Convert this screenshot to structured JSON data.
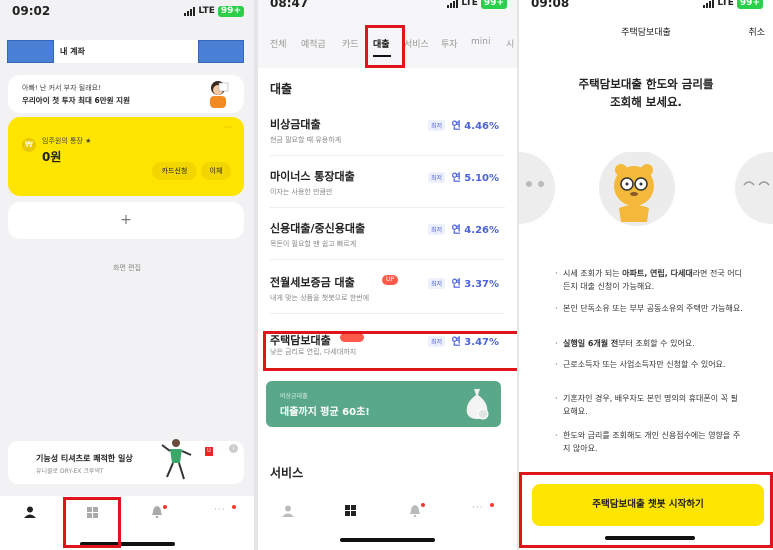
{
  "screen1": {
    "time": "09:02",
    "network": "LTE",
    "battery": "99+",
    "account_label": "내 계좌",
    "promo_line1": "아빠! 난 커서 부자 될래요!",
    "promo_line2": "우리아이 첫 투자 최대 6만원 지원",
    "account_name": "임주원의 통장 ★",
    "balance": "0원",
    "btn_card": "카드신청",
    "btn_transfer": "이체",
    "add_symbol": "+",
    "edit_screen": "화면 편집",
    "ad_title": "기능성 티셔츠로 쾌적한 일상",
    "ad_sub": "유니클로 DRY-EX 크루넥T",
    "ad_info": "i",
    "nav_more": "···"
  },
  "screen2": {
    "time": "08:47",
    "network": "LTE",
    "battery": "99+",
    "tabs": [
      "전체",
      "예적금",
      "카드",
      "대출",
      "서비스",
      "투자",
      "mini",
      "시"
    ],
    "section_title": "대출",
    "loans": [
      {
        "title": "비상금대출",
        "sub": "현금 필요할 때 유용하게",
        "badge": "최저",
        "rate": "연 4.46%"
      },
      {
        "title": "마이너스 통장대출",
        "sub": "이자는 사용한 만큼만",
        "badge": "최저",
        "rate": "연 5.10%"
      },
      {
        "title": "신용대출/중신용대출",
        "sub": "목돈이 필요할 땐 쉽고 빠르게",
        "badge": "최저",
        "rate": "연 4.26%"
      },
      {
        "title": "전월세보증금 대출",
        "sub": "내게 맞는 상품을 챗봇으로 한번에",
        "badge": "최저",
        "rate": "연 3.37%",
        "tag": "UP"
      },
      {
        "title": "주택담보대출",
        "sub": "낮은 금리로 연립, 다세대까지",
        "badge": "최저",
        "rate": "연 3.47%"
      }
    ],
    "banner_small": "비상금대출",
    "banner_big": "대출까지 평균 60초!",
    "services_title": "서비스",
    "nav_more": "···"
  },
  "screen3": {
    "time": "09:08",
    "network": "LTE",
    "battery": "99+",
    "header_title": "주택담보대출",
    "cancel": "취소",
    "headline1": "주택담보대출 한도와 금리를",
    "headline2": "조회해 보세요.",
    "bullets": [
      [
        "시세 조회가 되는 ",
        "아파트, 연립, 다세대",
        "라면 전국 어디든지 대출 신청이 가능해요."
      ],
      [
        "본인 단독소유 또는 부부 공동소유의 주택만 가능해요.",
        "",
        ""
      ],
      [
        "",
        "실행일 6개월 전",
        "부터 조회할 수 있어요."
      ],
      [
        "근로소득자 또는 사업소득자만 신청할 수 있어요.",
        "",
        ""
      ],
      [
        "기혼자인 경우, 배우자도 본인 명의의 휴대폰이 꼭 필요해요.",
        "",
        ""
      ],
      [
        "한도와 금리를 조회해도 개인 신용점수에는 영향을 주지 않아요.",
        "",
        ""
      ]
    ],
    "cta": "주택담보대출 챗봇 시작하기"
  },
  "colors": {
    "kakao_yellow": "#fee500",
    "highlight_red": "#e0151b",
    "rate_blue": "#4b63d8",
    "banner_green": "#5aa88a"
  }
}
